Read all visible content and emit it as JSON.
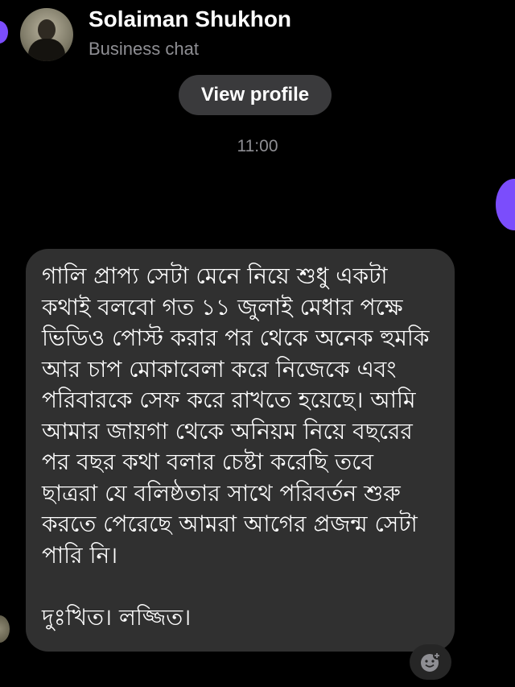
{
  "header": {
    "name": "Solaiman Shukhon",
    "subtitle": "Business chat",
    "avatar_icon": "profile-photo"
  },
  "profile_button": {
    "label": "View profile"
  },
  "timestamp": "11:00",
  "message": {
    "lines": [
      "গালি প্রাপ্য সেটা মেনে নিয়ে শুধু একটা",
      "কথাই বলবো গত ১১ জুলাই মেধার পক্ষে",
      "ভিডিও পোস্ট করার পর থেকে অনেক হুমকি",
      "আর চাপ মোকাবেলা করে নিজেকে এবং",
      "পরিবারকে সেফ  করে রাখতে হয়েছে। আমি",
      "আমার জায়গা থেকে অনিয়ম নিয়ে বছরের",
      "পর বছর কথা বলার চেষ্টা করেছি তবে",
      "ছাত্ররা যে বলিষ্ঠতার সাথে পরিবর্তন শুরু",
      "করতে পেরেছে আমরা আগের প্রজন্ম সেটা",
      "পারি নি।"
    ],
    "closing": "দুঃখিত। লজ্জিত।"
  },
  "reaction_button_icon": "add-reaction-icon",
  "colors": {
    "background": "#000000",
    "bubble": "#303030",
    "pill": "#3a3a3c",
    "secondary_text": "#8e8e93",
    "accent": "#7b4dfc"
  }
}
